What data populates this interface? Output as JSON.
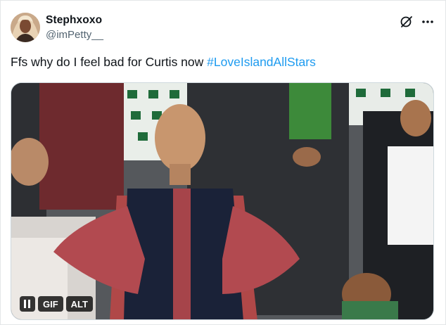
{
  "tweet": {
    "display_name": "Stephxoxo",
    "handle": "@imPetty__",
    "text_before": "Ffs why do I feel bad for Curtis now ",
    "hashtag": "#LoveIslandAllStars",
    "header_icons": [
      "grok-icon",
      "more-icon"
    ]
  },
  "media": {
    "description_icon": "pause-icon",
    "gif_label": "GIF",
    "alt_label": "ALT"
  },
  "colors": {
    "hashtag": "#1d9bf0",
    "handle": "#536471",
    "text": "#0f1419"
  }
}
